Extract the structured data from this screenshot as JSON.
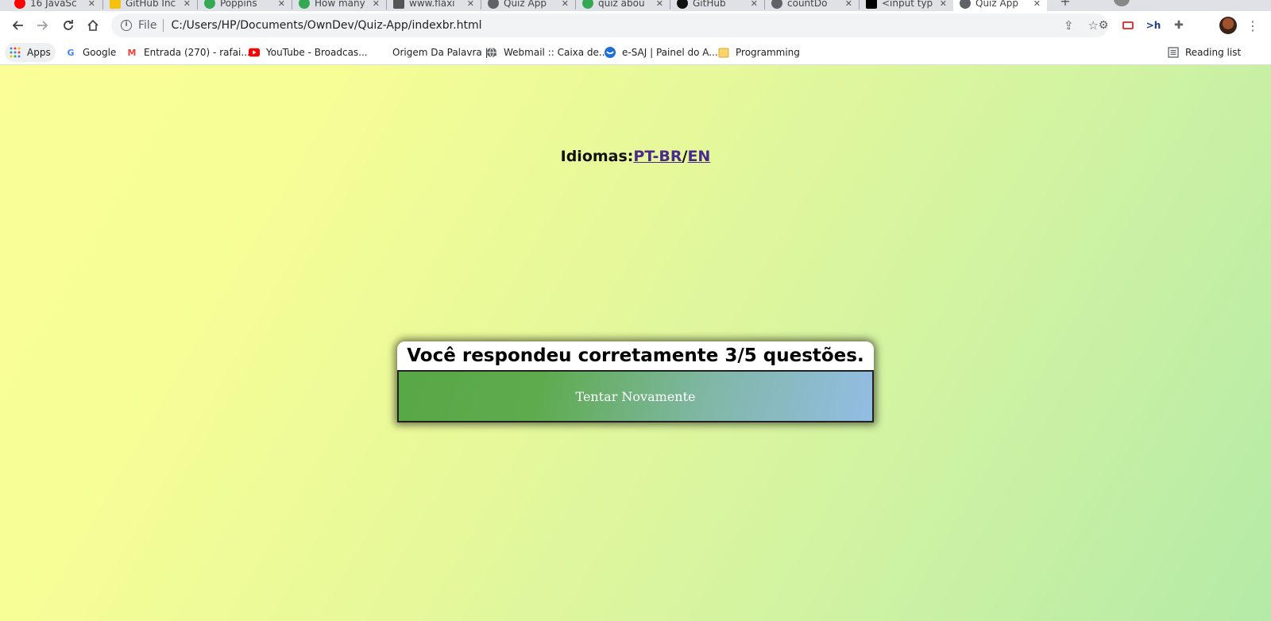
{
  "browser": {
    "tabs": [
      {
        "title": "16 JavaSc",
        "fav": "#ff0000"
      },
      {
        "title": "GitHub Inc",
        "fav": "#f4c20d"
      },
      {
        "title": "Poppins",
        "fav": "#34a853"
      },
      {
        "title": "How many",
        "fav": "#34a853"
      },
      {
        "title": "www.flaxi",
        "fav": "#555555"
      },
      {
        "title": "Quiz App",
        "fav": "#5f6368"
      },
      {
        "title": "quiz abou",
        "fav": "#34a853"
      },
      {
        "title": "GitHub",
        "fav": "#111111"
      },
      {
        "title": "countDo",
        "fav": "#5f6368"
      },
      {
        "title": "<input typ",
        "fav": "#000000"
      },
      {
        "title": "Quiz App",
        "fav": "#5f6368"
      }
    ],
    "address": {
      "scheme": "File",
      "url": "C:/Users/HP/Documents/OwnDev/Quiz-App/indexbr.html"
    },
    "bookmarks": [
      {
        "label": "Apps",
        "icon": "apps-grid-icon"
      },
      {
        "label": "Google",
        "icon": "google-icon"
      },
      {
        "label": "Entrada (270) - rafai...",
        "icon": "gmail-icon"
      },
      {
        "label": "YouTube - Broadcas...",
        "icon": "youtube-icon"
      },
      {
        "label": "Origem Da Palavra |...",
        "icon": "blank-icon"
      },
      {
        "label": "Webmail :: Caixa de...",
        "icon": "globe-icon"
      },
      {
        "label": "e-SAJ | Painel do A...",
        "icon": "shield-icon"
      },
      {
        "label": "Programming",
        "icon": "folder-icon"
      }
    ],
    "reading_list": "Reading list"
  },
  "page": {
    "language_label": "Idiomas:",
    "lang_pt": "PT-BR",
    "lang_sep": "/",
    "lang_en": "EN",
    "result_text": "Você respondeu corretamente 3/5 questões.",
    "retry_button": "Tentar Novamente"
  },
  "colors": {
    "gradient_start": "#fbfe97",
    "gradient_end": "#b4eaa7",
    "button_gradient_start": "#58a846",
    "button_gradient_end": "#93bde4",
    "link": "#4a2a8a"
  }
}
